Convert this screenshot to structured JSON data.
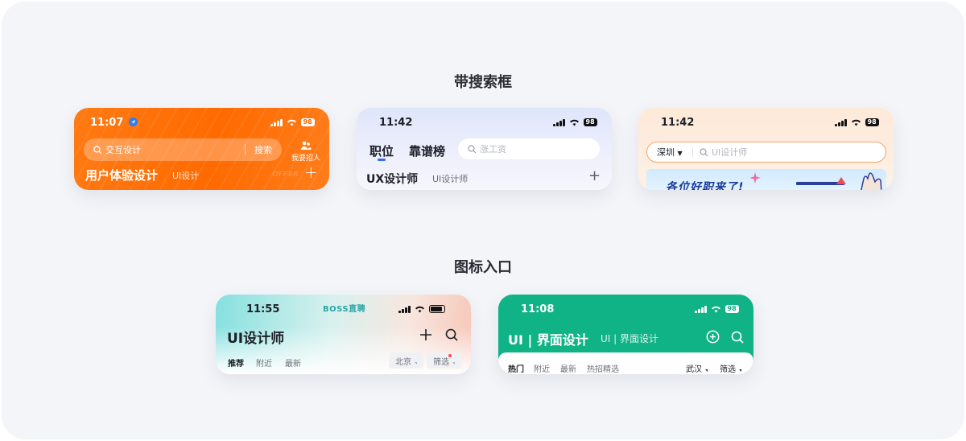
{
  "sections": {
    "search_title": "带搜索框",
    "icon_title": "图标入口"
  },
  "card_orange": {
    "time": "11:07",
    "battery": "98",
    "search_placeholder": "交互设计",
    "search_button": "搜索",
    "recruit_label": "我要招人",
    "title": "用户体验设计",
    "subtitle": "UI设计",
    "watermark": "OFFER",
    "accent": "#ff6a00"
  },
  "card_lavender": {
    "time": "11:42",
    "battery": "98",
    "tab_jobs": "职位",
    "tab_reliable": "靠谱榜",
    "search_placeholder": "涨工资",
    "title": "UX设计师",
    "subtitle": "UI设计师",
    "accent": "#2f6dff"
  },
  "card_peach": {
    "time": "11:42",
    "battery": "98",
    "city": "深圳",
    "search_placeholder": "UI设计师",
    "banner_text": "各位好职来了!",
    "accent": "#f1a46a"
  },
  "card_gradient": {
    "time": "11:55",
    "brand": "BOSS直聘",
    "title": "UI设计师",
    "tabs": [
      "推荐",
      "附近",
      "最新"
    ],
    "chip_city": "北京",
    "chip_filter": "筛选",
    "accent": "#2aa6a6"
  },
  "card_green": {
    "time": "11:08",
    "battery": "98",
    "title": "UI | 界面设计",
    "subtitle": "UI | 界面设计",
    "tabs": [
      "热门",
      "附近",
      "最新",
      "热招精选"
    ],
    "city_filter": "武汉",
    "filter": "筛选",
    "accent": "#10b386"
  }
}
